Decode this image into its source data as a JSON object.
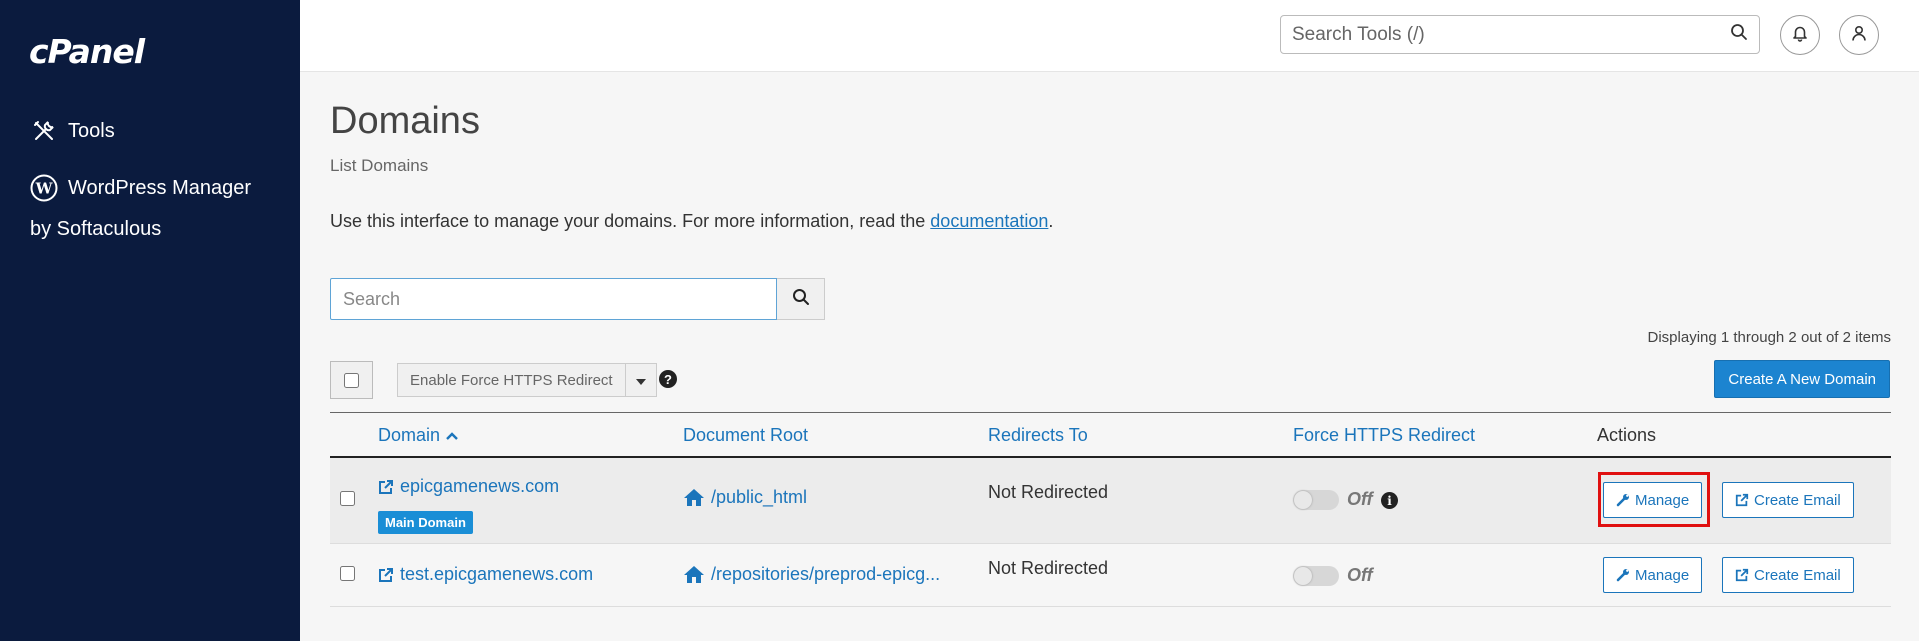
{
  "sidebar": {
    "logo": "cPanel",
    "items": [
      {
        "label": "Tools",
        "icon": "tools-icon"
      },
      {
        "label": "WordPress Manager",
        "label_line2": "by Softaculous",
        "icon": "wordpress-icon"
      }
    ]
  },
  "header": {
    "search_placeholder": "Search Tools (/)",
    "icons": [
      "search-icon",
      "bell-icon",
      "user-icon"
    ]
  },
  "main": {
    "title": "Domains",
    "subtitle": "List Domains",
    "intro_text": "Use this interface to manage your domains. For more information, read the ",
    "intro_link": "documentation",
    "intro_end": ".",
    "search_placeholder": "Search",
    "displaying": "Displaying 1 through 2 out of 2 items",
    "bulk_action_label": "Enable Force HTTPS Redirect",
    "help_glyph": "?",
    "create_button": "Create A New Domain"
  },
  "table": {
    "headers": {
      "domain": "Domain",
      "document_root": "Document Root",
      "redirects_to": "Redirects To",
      "force_https": "Force HTTPS Redirect",
      "actions": "Actions"
    },
    "sort": {
      "column": "domain",
      "direction": "ascending"
    },
    "rows": [
      {
        "domain": "epicgamenews.com",
        "badge": "Main Domain",
        "document_root": "/public_html",
        "redirects_to": "Not Redirected",
        "force_https_state": "Off",
        "info_glyph": "i",
        "manage_label": "Manage",
        "create_email_label": "Create Email"
      },
      {
        "domain": "test.epicgamenews.com",
        "document_root": "/repositories/preprod-epicg...",
        "redirects_to": "Not Redirected",
        "force_https_state": "Off",
        "manage_label": "Manage",
        "create_email_label": "Create Email"
      }
    ]
  },
  "colors": {
    "sidebar_bg": "#0b1b3e",
    "link": "#1b75bb",
    "primary_button": "#1c84d0",
    "badge": "#1a8ed6",
    "highlight": "#e01010"
  }
}
